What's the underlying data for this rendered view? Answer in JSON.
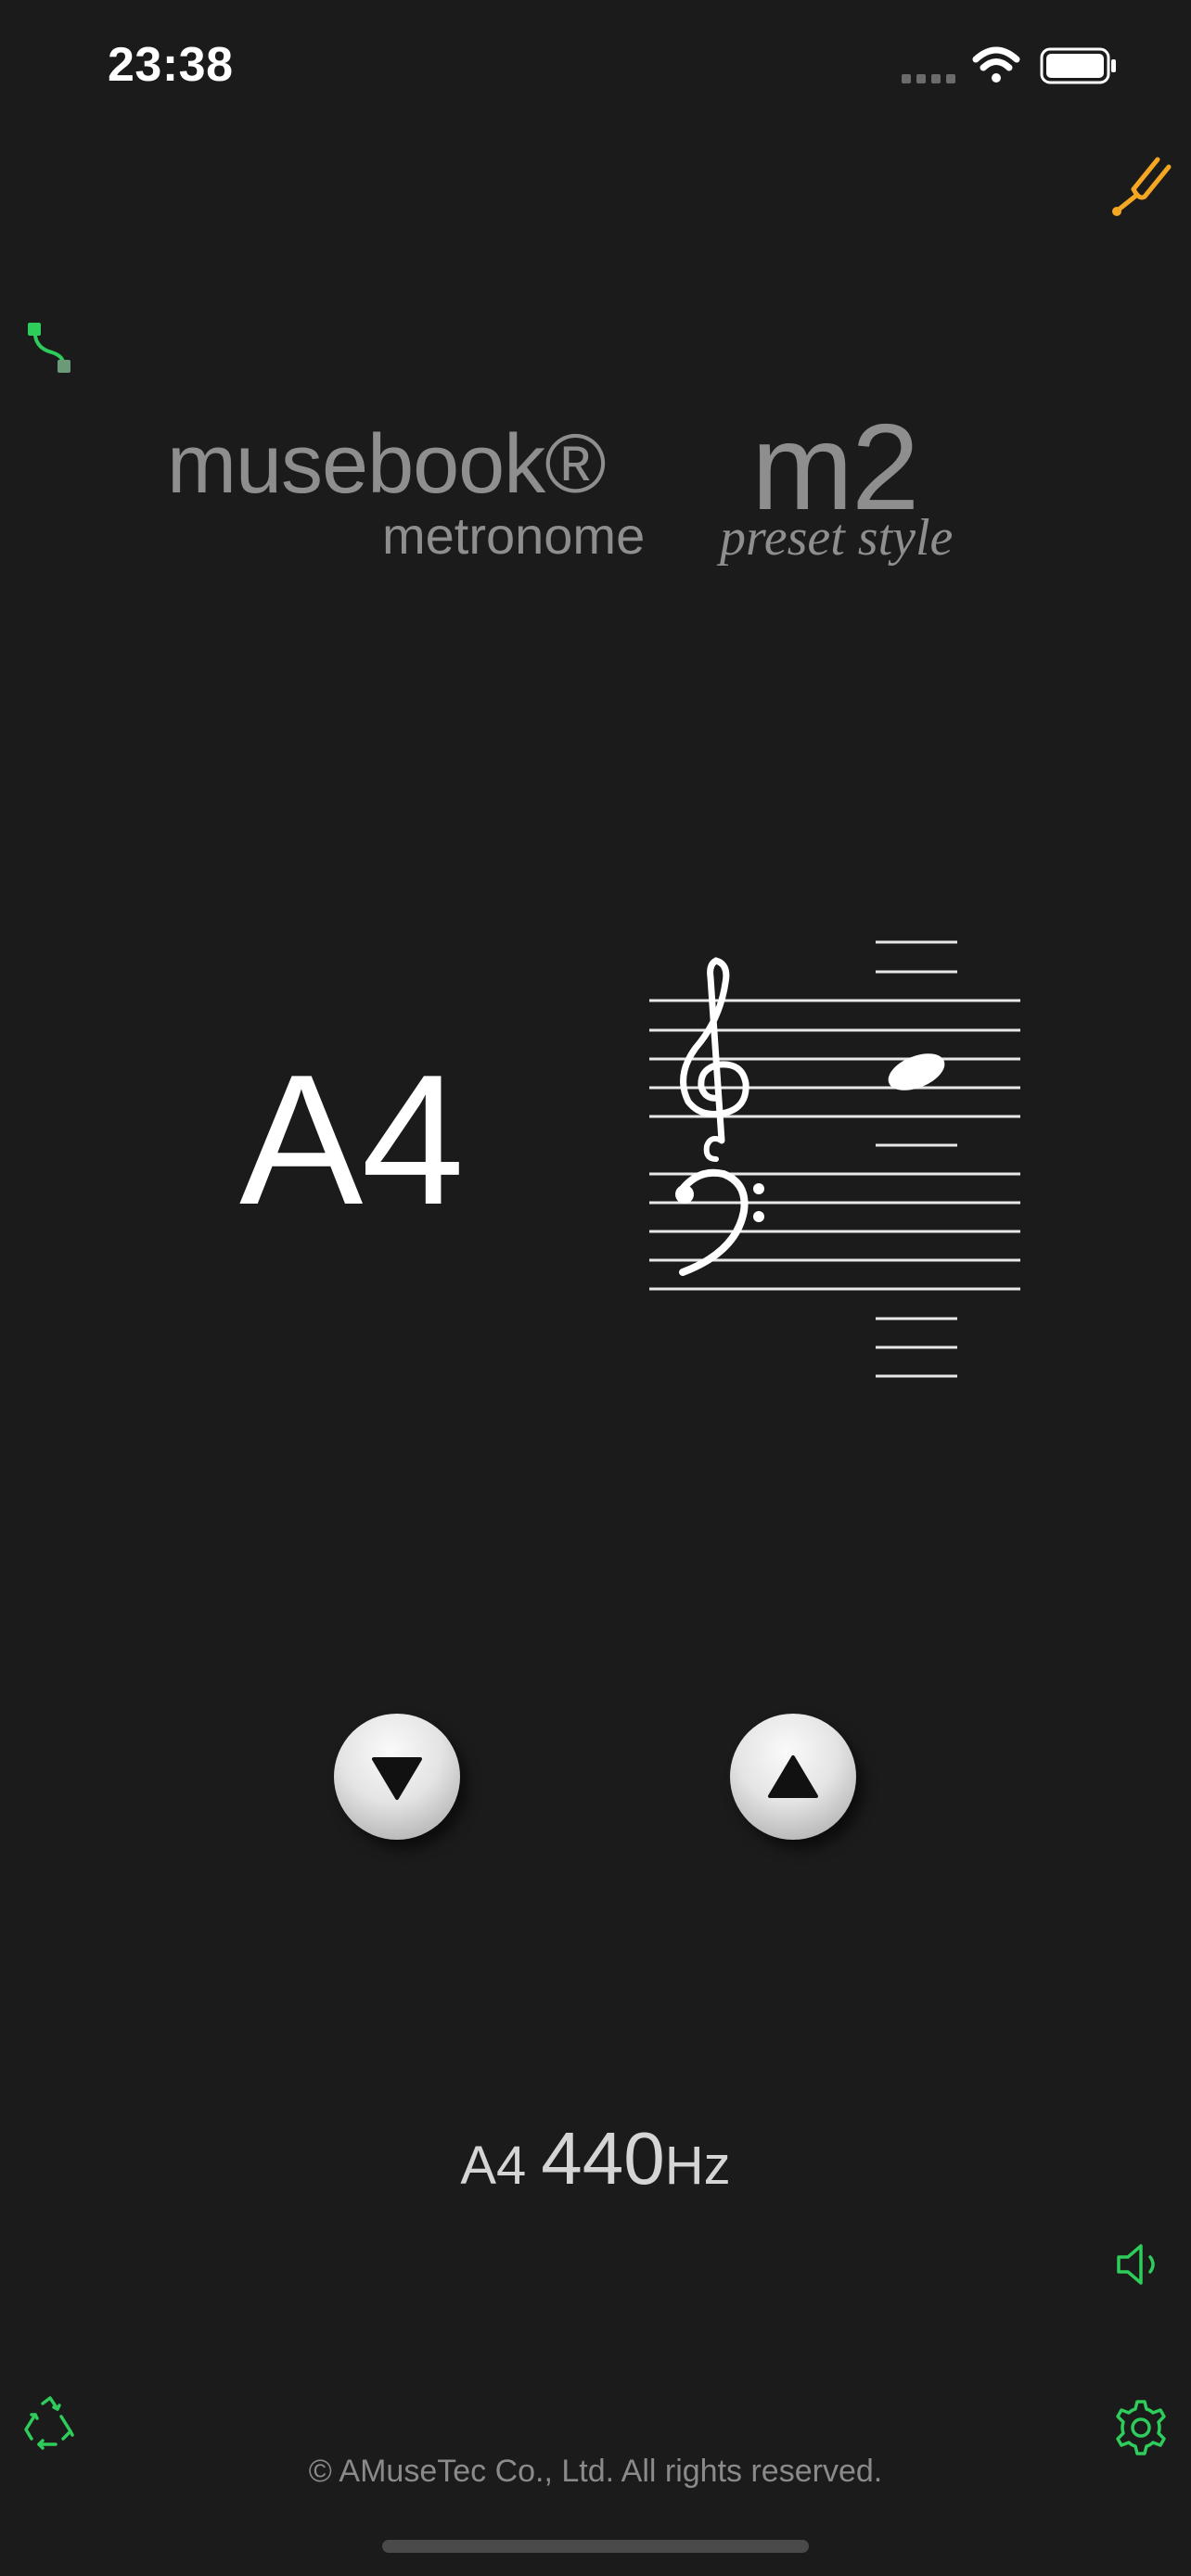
{
  "status_bar": {
    "time": "23:38",
    "icons": [
      "signal-icon",
      "wifi-icon",
      "battery-icon"
    ]
  },
  "brand": {
    "name": "musebook®",
    "product": "metronome",
    "style_name": "m2",
    "style_label": "preset style"
  },
  "tuner": {
    "note": "A4",
    "staff_note": "A4",
    "reference": {
      "note": "A4",
      "value": "440",
      "unit": "Hz"
    }
  },
  "controls": {
    "down_icon": "triangle-down-icon",
    "up_icon": "triangle-up-icon",
    "top_right_icon": "tuning-fork-icon",
    "top_left_icon": "route-icon",
    "bottom_left_icon": "recycle-icon",
    "bottom_right_icon": "gear-icon",
    "right_icon": "speaker-icon"
  },
  "colors": {
    "background": "#1b1b1b",
    "accent_green": "#2ecc5a",
    "accent_orange": "#f5a623",
    "text_gray": "#8e8e8e"
  },
  "footer": {
    "copyright": "© AMuseTec Co., Ltd. All rights reserved."
  }
}
